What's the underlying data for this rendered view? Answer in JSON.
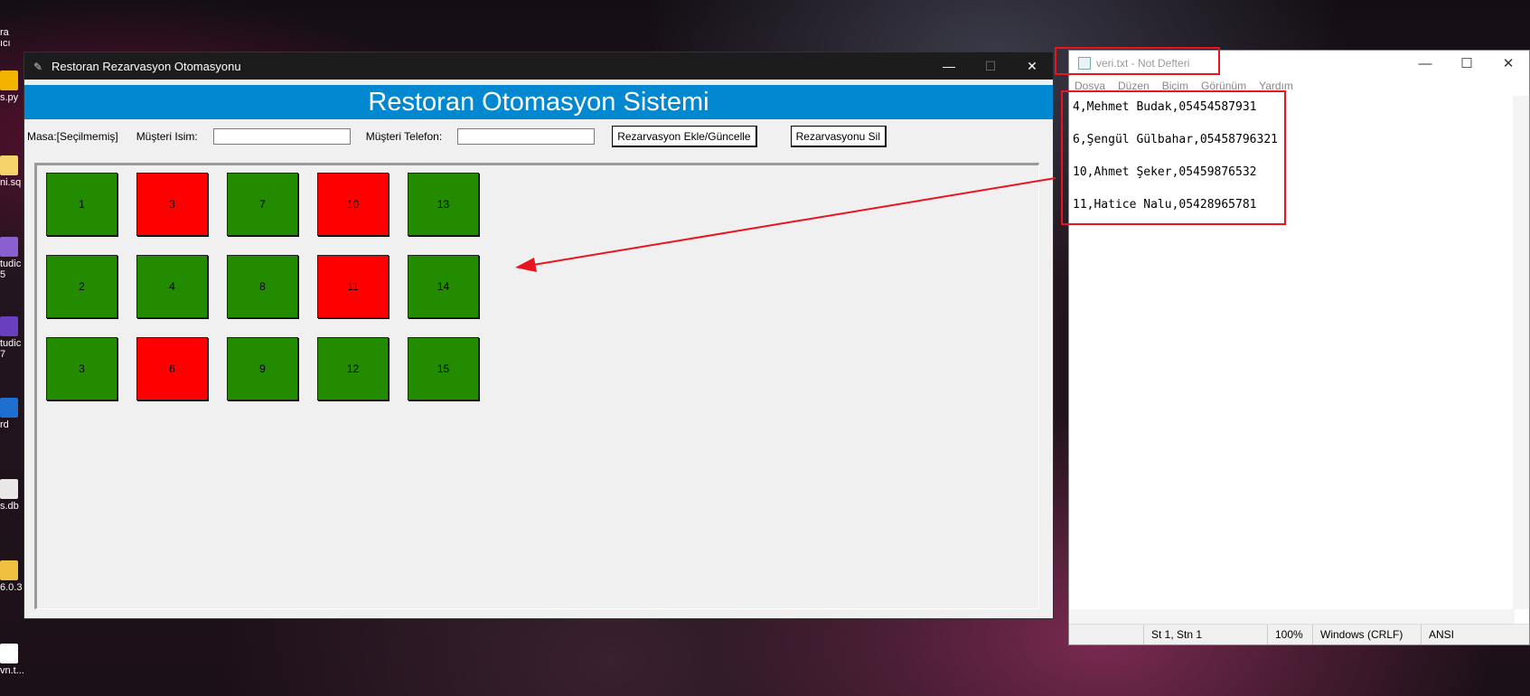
{
  "desktop_icons": [
    {
      "label": "ra"
    },
    {
      "label": "ıcı"
    },
    {
      "label": "s.py"
    },
    {
      "label": "ni.sq"
    },
    {
      "label": "tudic"
    },
    {
      "label": "5"
    },
    {
      "label": "tudic"
    },
    {
      "label": "7"
    },
    {
      "label": "rd"
    },
    {
      "label": "s.db"
    },
    {
      "label": "6.0.3"
    },
    {
      "label": "vn.t..."
    }
  ],
  "app": {
    "window_title": "Restoran Rezarvasyon Otomasyonu",
    "header": "Restoran Otomasyon Sistemi",
    "masa_label": "Masa:[Seçilmemiş]",
    "name_label": "Müşteri Isim:",
    "name_value": "",
    "phone_label": "Müşteri Telefon:",
    "phone_value": "",
    "add_button": "Rezarvasyon Ekle/Güncelle",
    "delete_button": "Rezarvasyonu Sil",
    "colors": {
      "free": "#228b00",
      "reserved": "#ff0000",
      "header": "#0288d1"
    },
    "tables": [
      {
        "label": "1",
        "status": "free"
      },
      {
        "label": "3",
        "status": "reserved"
      },
      {
        "label": "7",
        "status": "free"
      },
      {
        "label": "10",
        "status": "reserved"
      },
      {
        "label": "13",
        "status": "free"
      },
      {
        "label": "2",
        "status": "free"
      },
      {
        "label": "4",
        "status": "free"
      },
      {
        "label": "8",
        "status": "free"
      },
      {
        "label": "11",
        "status": "reserved"
      },
      {
        "label": "14",
        "status": "free"
      },
      {
        "label": "3",
        "status": "free"
      },
      {
        "label": "6",
        "status": "reserved"
      },
      {
        "label": "9",
        "status": "free"
      },
      {
        "label": "12",
        "status": "free"
      },
      {
        "label": "15",
        "status": "free"
      }
    ]
  },
  "notepad": {
    "title": "veri.txt - Not Defteri",
    "menu": [
      "Dosya",
      "Düzen",
      "Biçim",
      "Görünüm",
      "Yardım"
    ],
    "lines": [
      "4,Mehmet Budak,05454587931",
      "6,Şengül Gülbahar,05458796321",
      "10,Ahmet Şeker,05459876532",
      "11,Hatice Nalu,05428965781"
    ],
    "status": {
      "position": "St 1, Stn 1",
      "zoom": "100%",
      "line_ending": "Windows (CRLF)",
      "encoding": "ANSI"
    }
  },
  "annotation_color": "#e8141e"
}
